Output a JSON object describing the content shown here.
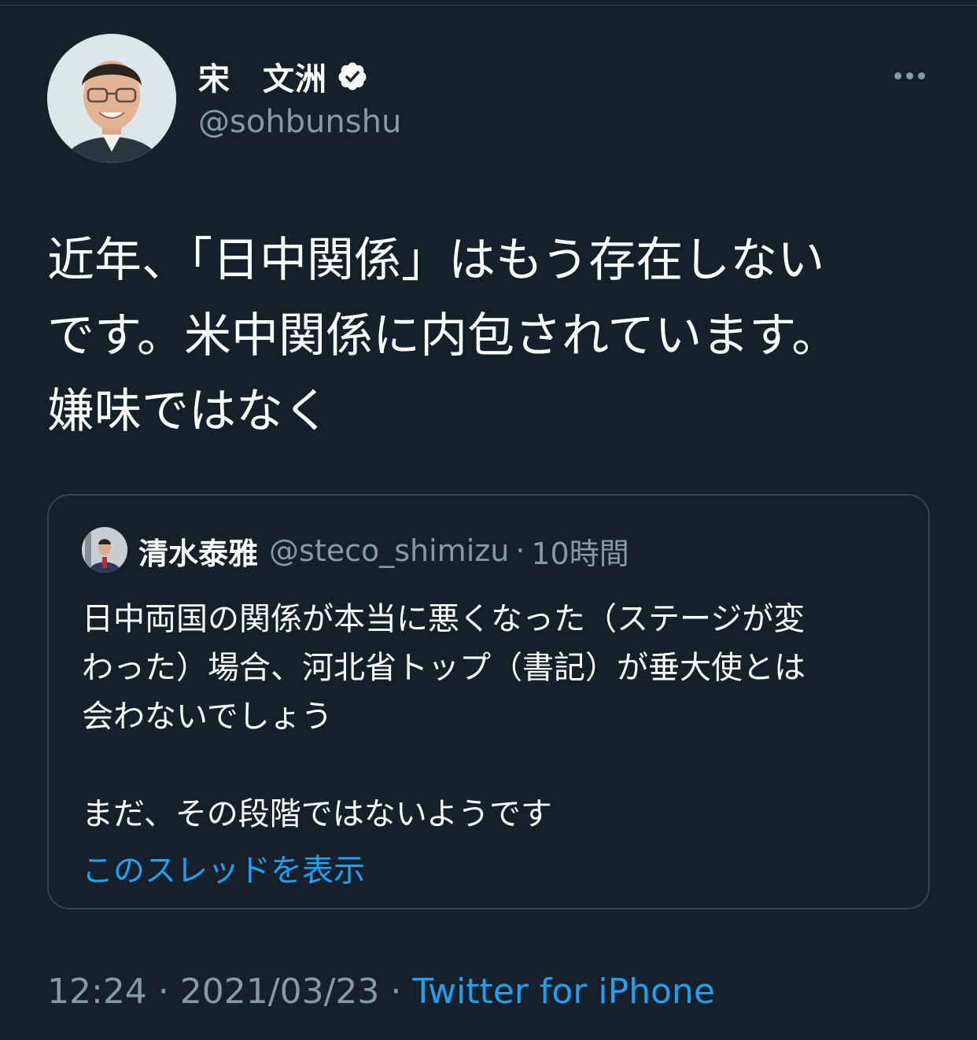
{
  "author": {
    "name": "宋　文洲",
    "handle": "@sohbunshu",
    "verified": true
  },
  "tweet": {
    "text": "近年、「日中関係」はもう存在しない\nです。米中関係に内包されています。\n嫌味ではなく"
  },
  "quote": {
    "name": "清水泰雅",
    "handle": "@steco_shimizu",
    "separator": "·",
    "time": "10時間",
    "text": "日中両国の関係が本当に悪くなった（ステージが変\nわった）場合、河北省トップ（書記）が垂大使とは\n会わないでしょう\n\nまだ、その段階ではないようです",
    "show_thread": "このスレッドを表示"
  },
  "meta": {
    "time": "12:24",
    "sep1": "·",
    "date": "2021/03/23",
    "sep2": "·",
    "source": "Twitter for iPhone"
  },
  "icons": {
    "verified": "verified-badge-icon",
    "more": "more-horizontal-icon"
  },
  "colors": {
    "background": "#15202b",
    "border": "#38444d",
    "secondary_text": "#8899a6",
    "link": "#1da1f2"
  }
}
